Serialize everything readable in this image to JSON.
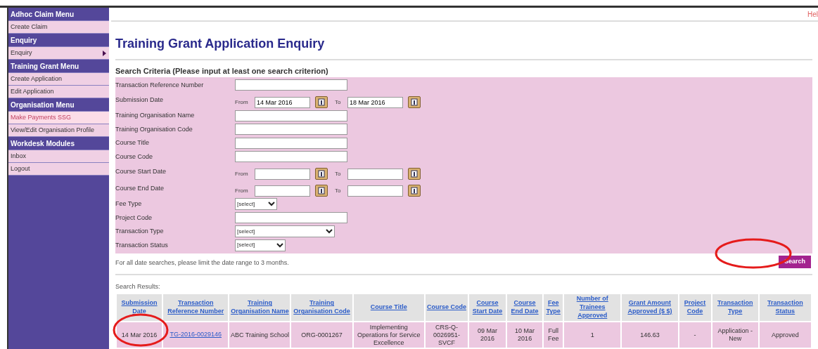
{
  "sidebar": {
    "sections": [
      {
        "title": "Adhoc Claim Menu",
        "items": [
          {
            "label": "Create Claim",
            "kind": "link",
            "selected": false
          }
        ]
      },
      {
        "title": "Enquiry",
        "items": [
          {
            "label": "Enquiry",
            "kind": "submenu",
            "selected": false
          }
        ]
      },
      {
        "title": "Training Grant Menu",
        "items": [
          {
            "label": "Create Application",
            "kind": "link",
            "selected": false
          },
          {
            "label": "Edit Application",
            "kind": "link",
            "selected": false
          }
        ]
      },
      {
        "title": "Organisation Menu",
        "items": [
          {
            "label": "Make Payments SSG",
            "kind": "link",
            "selected": true
          },
          {
            "label": "View/Edit Organisation Profile",
            "kind": "link",
            "selected": false
          }
        ]
      },
      {
        "title": "Workdesk Modules",
        "items": [
          {
            "label": "Inbox",
            "kind": "link",
            "selected": false
          },
          {
            "label": "Logout",
            "kind": "link",
            "selected": false
          }
        ]
      }
    ]
  },
  "top_bar": {
    "link": "Hel"
  },
  "page_title": "Training Grant Application Enquiry",
  "search_criteria": {
    "heading": "Search Criteria (Please input at least one search criterion)",
    "fields": [
      {
        "kind": "text",
        "label": "Transaction Reference Number"
      },
      {
        "kind": "daterange",
        "label": "Submission Date",
        "from_label": "From",
        "from_value": "14 Mar 2016",
        "to_label": "To",
        "to_value": "18 Mar 2016"
      },
      {
        "kind": "text",
        "label": "Training Organisation Name"
      },
      {
        "kind": "text",
        "label": "Training Organisation Code"
      },
      {
        "kind": "text",
        "label": "Course Title"
      },
      {
        "kind": "text",
        "label": "Course Code"
      },
      {
        "kind": "daterange",
        "label": "Course Start Date",
        "from_label": "From",
        "to_label": "To"
      },
      {
        "kind": "daterange",
        "label": "Course End Date",
        "from_label": "From",
        "to_label": "To"
      },
      {
        "kind": "select",
        "label": "Fee Type",
        "value": "[select]"
      },
      {
        "kind": "text",
        "label": "Project Code"
      },
      {
        "kind": "select",
        "label": "Transaction Type",
        "value": "[select]"
      },
      {
        "kind": "select",
        "label": "Transaction Status",
        "value": "[select]"
      }
    ],
    "note": "For all date searches, please limit the date range to 3 months.",
    "search_button": "Search"
  },
  "results": {
    "heading": "Search Results:",
    "columns": [
      "Submission Date",
      "Transaction Reference Number",
      "Training Organisation Name",
      "Training Organisation Code",
      "Course Title",
      "Course Code",
      "Course Start Date",
      "Course End Date",
      "Fee Type",
      "Number of Trainees Approved",
      "Grant Amount Approved ($ $)",
      "Project Code",
      "Transaction Type",
      "Transaction Status"
    ],
    "rows": [
      {
        "cells": [
          {
            "kind": "text",
            "text": "14 Mar 2016"
          },
          {
            "kind": "link",
            "text": "TG-2016-0029146"
          },
          {
            "kind": "text",
            "text": "ABC Training School"
          },
          {
            "kind": "text",
            "text": "ORG-0001267"
          },
          {
            "kind": "text",
            "text": "Implementing Operations for Service Excellence"
          },
          {
            "kind": "text",
            "text": "CRS-Q-0026951-SVCF"
          },
          {
            "kind": "text",
            "text": "09 Mar 2016"
          },
          {
            "kind": "text",
            "text": "10 Mar 2016"
          },
          {
            "kind": "text",
            "text": "Full Fee"
          },
          {
            "kind": "text",
            "text": "1"
          },
          {
            "kind": "text",
            "text": "146.63"
          },
          {
            "kind": "text",
            "text": "-"
          },
          {
            "kind": "text",
            "text": "Application - New"
          },
          {
            "kind": "text",
            "text": "Approved"
          }
        ]
      }
    ]
  }
}
